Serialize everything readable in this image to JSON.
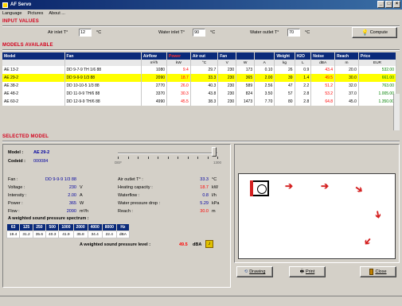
{
  "window": {
    "title": "AF Servo"
  },
  "menu": [
    "Language",
    "Pictures",
    "About ..."
  ],
  "input_values": {
    "title": "INPUT VALUES",
    "air_inlet_label": "Air inlet T°",
    "air_inlet_value": "12",
    "water_inlet_label": "Water inlet T°",
    "water_inlet_value": "90",
    "water_outlet_label": "Water outlet T°",
    "water_outlet_value": "70",
    "unit": "°C",
    "compute_label": "Compute"
  },
  "models": {
    "title": "MODELS AVAILABLE",
    "headers": [
      "Model",
      "Fan",
      "Airflow",
      "Power",
      "Air out",
      "Fan",
      "",
      "",
      "Weight",
      "H2O",
      "Noise",
      "Reach",
      "Price"
    ],
    "units": [
      "",
      "",
      "m³/h",
      "kW",
      "°C",
      "V",
      "W",
      "A",
      "kg",
      "L",
      "dBA",
      "m",
      "EUR"
    ],
    "rows": [
      [
        "AE 13-2",
        "DD 9-7-9 TH 1/6 88",
        "1080",
        "9.4",
        "29.7",
        "230",
        "173",
        "0.10",
        "26",
        "0.9",
        "43.4",
        "20.0",
        "532.00"
      ],
      [
        "AE 29-2",
        "DD 9-9-9 1/3 88",
        "2090",
        "18.7",
        "33.3",
        "230",
        "365",
        "2.00",
        "39",
        "1.4",
        "49.5",
        "30.0",
        "661.00"
      ],
      [
        "AE 38-2",
        "DD 10-10-5 1/3 88",
        "2770",
        "26.0",
        "40.3",
        "230",
        "589",
        "2.56",
        "47",
        "2.2",
        "51.2",
        "32.0",
        "763.00"
      ],
      [
        "AE 48-2",
        "DD 11-9-9 TH/6 88",
        "3370",
        "30.3",
        "43.8",
        "230",
        "824",
        "3.50",
        "57",
        "2.8",
        "53.2",
        "37.0",
        "1.005.00"
      ],
      [
        "AE 60-2",
        "DD 12-9-9 TH/6 88",
        "4990",
        "45.5",
        "38.3",
        "230",
        "1473",
        "7.70",
        "80",
        "2.8",
        "64.8",
        "45.0",
        "1.350.00"
      ]
    ],
    "selected_index": 1
  },
  "selected": {
    "title": "SELECTED MODEL",
    "model_label": "Model :",
    "model_value": "AE 29-2",
    "code_label": "Codeid :",
    "code_value": "000084",
    "slider_min": "DEF",
    "slider_max": "1300",
    "slider_fraction": 0.97,
    "left_fields": [
      {
        "label": "Fan :",
        "value": "DD 9-9-9 1/3 88",
        "unit": ""
      },
      {
        "label": "Voltage :",
        "value": "230",
        "unit": "V"
      },
      {
        "label": "Intensity :",
        "value": "2.00",
        "unit": "A"
      },
      {
        "label": "Power :",
        "value": "365",
        "unit": "W"
      },
      {
        "label": "Flow :",
        "value": "2090",
        "unit": "m³/h"
      }
    ],
    "right_fields": [
      {
        "label": "Air outlet T° :",
        "value": "33.3",
        "unit": "°C",
        "color": "blue"
      },
      {
        "label": "Heating capacity :",
        "value": "18.7",
        "unit": "kW",
        "color": "red"
      },
      {
        "label": "Waterflow :",
        "value": "0.8",
        "unit": "l/h",
        "color": "blue"
      },
      {
        "label": "Water pressure drop :",
        "value": "5.29",
        "unit": "kPa",
        "color": "blue"
      },
      {
        "label": "Reach :",
        "value": "30.0",
        "unit": "m",
        "color": "red"
      }
    ],
    "spectrum_label": "A weighted sound pressure spectrum :",
    "spectrum_freqs": [
      "63",
      "125",
      "250",
      "500",
      "1000",
      "2000",
      "4000",
      "8000",
      "Hz"
    ],
    "spectrum_values": [
      "19.4",
      "31.2",
      "35.6",
      "40.3",
      "41.9",
      "35.8",
      "34.4",
      "22.4",
      "dBA"
    ],
    "level_label": "A weighted sound pressure level :",
    "level_value": "49.5",
    "level_unit": "dBA"
  },
  "buttons": {
    "drawing": "Drawing",
    "print": "Print",
    "close": "Close"
  }
}
